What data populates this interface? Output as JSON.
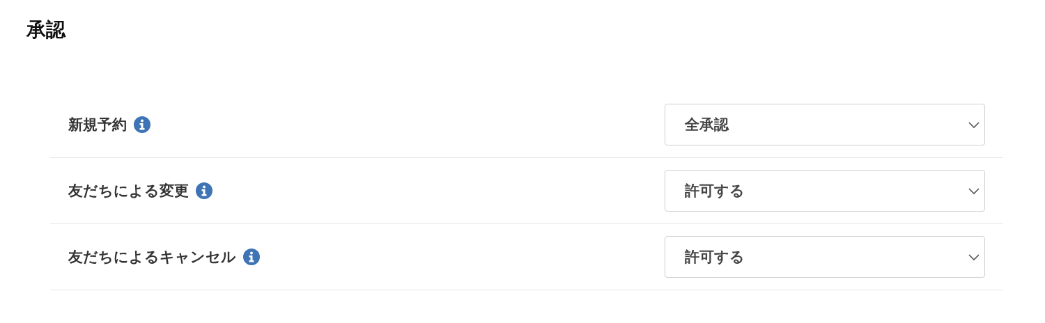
{
  "title": "承認",
  "settings": [
    {
      "label": "新規予約",
      "value": "全承認"
    },
    {
      "label": "友だちによる変更",
      "value": "許可する"
    },
    {
      "label": "友だちによるキャンセル",
      "value": "許可する"
    }
  ]
}
